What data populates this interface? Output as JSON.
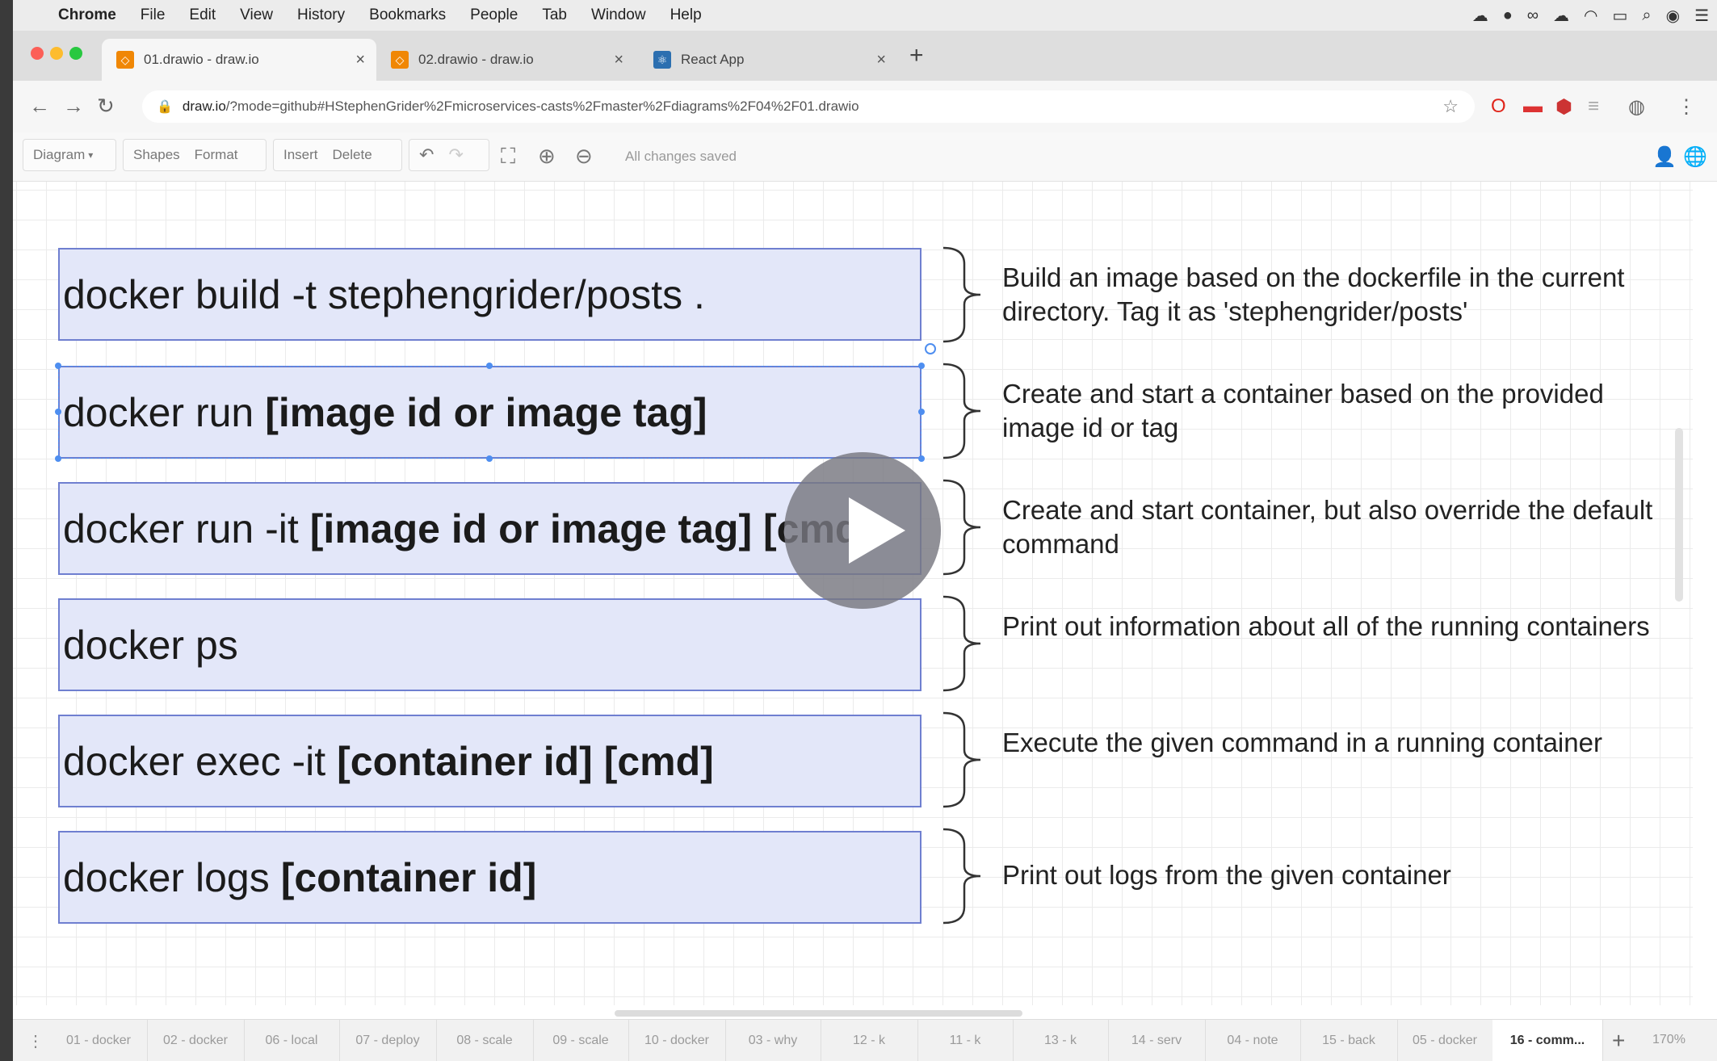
{
  "menubar": {
    "apple": "",
    "app": "Chrome",
    "items": [
      "File",
      "Edit",
      "View",
      "History",
      "Bookmarks",
      "People",
      "Tab",
      "Window",
      "Help"
    ]
  },
  "tabs": [
    {
      "title": "01.drawio - draw.io",
      "icon": "drawio-icon",
      "active": true
    },
    {
      "title": "02.drawio - draw.io",
      "icon": "drawio-icon",
      "active": false
    },
    {
      "title": "React App",
      "icon": "react-icon",
      "active": false
    }
  ],
  "address": {
    "host": "draw.io",
    "path": "/?mode=github#HStephenGrider%2Fmicroservices-casts%2Fmaster%2Fdiagrams%2F04%2F01.drawio"
  },
  "toolbar": {
    "diagram": "Diagram",
    "shapes": "Shapes",
    "format": "Format",
    "insert": "Insert",
    "delete": "Delete",
    "status": "All changes saved"
  },
  "commands": [
    {
      "plain": "docker build -t stephengrider/posts .",
      "bold": "",
      "description": "Build an image based on the dockerfile in the current directory.  Tag it as 'stephengrider/posts'"
    },
    {
      "plain": "docker run",
      "bold": "[image id or image tag]",
      "description": "Create and start a container based on the provided image id or tag"
    },
    {
      "plain": "docker run -it",
      "bold": "[image id or image tag] [cmd]",
      "description": "Create and start container, but also override the default command"
    },
    {
      "plain": "docker ps",
      "bold": "",
      "description": "Print out information about all of the running containers"
    },
    {
      "plain": "docker exec -it",
      "bold": "[container id] [cmd]",
      "description": "Execute the given command in a running container"
    },
    {
      "plain": "docker logs",
      "bold": "[container id]",
      "description": "Print out logs from the given container"
    }
  ],
  "pages": [
    "01 - docker",
    "02 - docker",
    "06 - local",
    "07 - deploy",
    "08 - scale",
    "09 - scale",
    "10 - docker",
    "03 - why",
    "12 - k",
    "11 - k",
    "13 - k",
    "14 - serv",
    "04 - note",
    "15 - back",
    "05 - docker",
    "16 - comm..."
  ],
  "active_page": 15,
  "zoom": "170%",
  "colors": {
    "box_fill": "#e3e7f9",
    "box_border": "#6f7fd0",
    "selection": "#4e8ef0"
  }
}
